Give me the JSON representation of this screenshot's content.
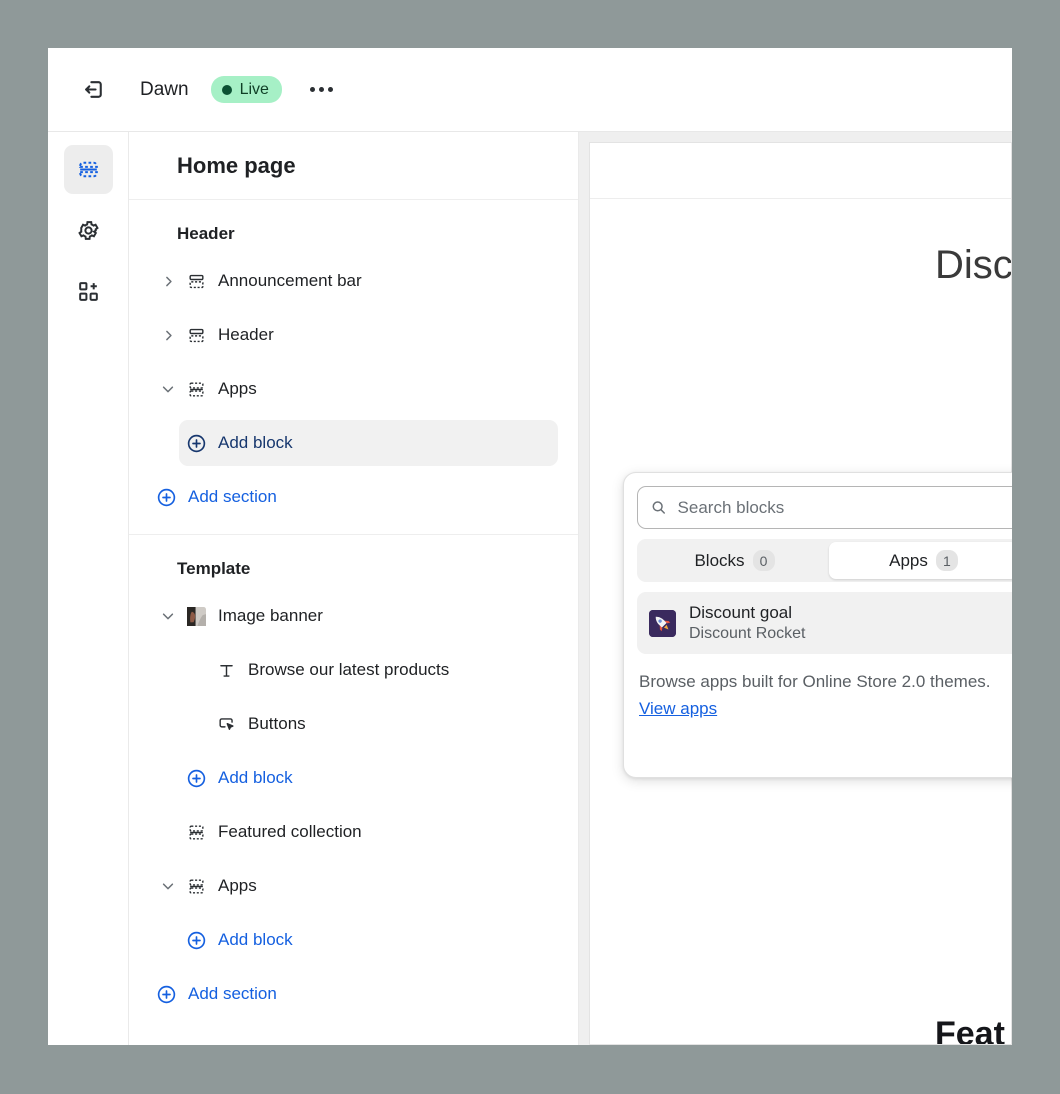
{
  "topbar": {
    "exit_icon": "exit-icon",
    "theme_name": "Dawn",
    "status_label": "Live",
    "more_icon": "ellipsis-icon"
  },
  "rail": {
    "items": [
      {
        "icon": "sections-icon",
        "name": "sections",
        "active": true
      },
      {
        "icon": "gear-icon",
        "name": "settings",
        "active": false
      },
      {
        "icon": "apps-grid-icon",
        "name": "apps",
        "active": false
      }
    ]
  },
  "sidebar": {
    "title": "Home page",
    "groups": [
      {
        "label": "Header",
        "rows": [
          {
            "label": "Announcement bar",
            "icon": "section-dashed-bottom-icon",
            "chevron": "right"
          },
          {
            "label": "Header",
            "icon": "section-dashed-bottom-icon",
            "chevron": "right"
          },
          {
            "label": "Apps",
            "icon": "section-dashed-both-icon",
            "chevron": "down"
          }
        ],
        "add_block": "Add block",
        "add_section": "Add section"
      },
      {
        "label": "Template",
        "rows": [
          {
            "label": "Image banner",
            "icon": "image-thumbnail-icon",
            "chevron": "down"
          },
          {
            "label": "Browse our latest products",
            "icon": "text-icon",
            "chevron": "none"
          },
          {
            "label": "Buttons",
            "icon": "button-cursor-icon",
            "chevron": "none"
          }
        ],
        "add_block_1": "Add block",
        "rows2": [
          {
            "label": "Featured collection",
            "icon": "section-dashed-both-icon",
            "chevron": "none"
          },
          {
            "label": "Apps",
            "icon": "section-dashed-both-icon",
            "chevron": "down"
          }
        ],
        "add_block_2": "Add block",
        "add_section": "Add section"
      }
    ]
  },
  "preview": {
    "hero_text": "Disc",
    "bottom_text": "Feat"
  },
  "popover": {
    "search_placeholder": "Search blocks",
    "search_value": "",
    "search_icon": "search-icon",
    "tabs": [
      {
        "label": "Blocks",
        "count": "0",
        "active": false
      },
      {
        "label": "Apps",
        "count": "1",
        "active": true
      }
    ],
    "app_item": {
      "title": "Discount goal",
      "subtitle": "Discount Rocket",
      "icon": "rocket-icon",
      "emoji": "🚀"
    },
    "footer_text": "Browse apps built for Online Store 2.0 themes.",
    "footer_link": "View apps"
  },
  "colors": {
    "accent_blue": "#1560e0",
    "selected_blue": "#17376e",
    "live_bg": "#a6f0c6",
    "live_fg": "#0f3f26",
    "page_bg": "#8f9999"
  }
}
